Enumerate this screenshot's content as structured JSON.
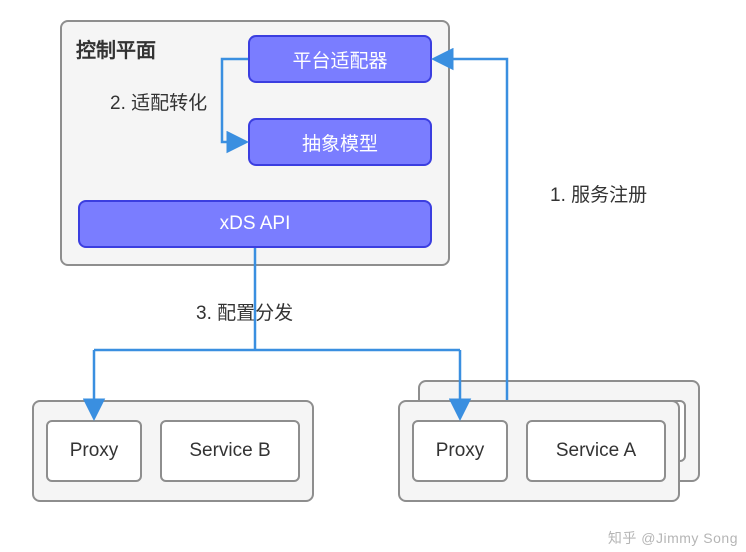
{
  "controlPlane": {
    "title": "控制平面",
    "adapterLabel": "平台适配器",
    "modelLabel": "抽象模型",
    "xdsLabel": "xDS API",
    "adaptAnnotation": "2. 适配转化"
  },
  "annotations": {
    "serviceRegister": "1. 服务注册",
    "configDispatch": "3. 配置分发"
  },
  "podB": {
    "proxyLabel": "Proxy",
    "serviceLabel": "Service B"
  },
  "podA": {
    "proxyLabel": "Proxy",
    "serviceLabel": "Service A"
  },
  "watermark": "知乎 @Jimmy Song",
  "colors": {
    "arrow": "#3a8fe0",
    "purpleFill": "#7a7dff",
    "purpleBorder": "#3b3ee0",
    "grayBorder": "#8e8e8e"
  }
}
